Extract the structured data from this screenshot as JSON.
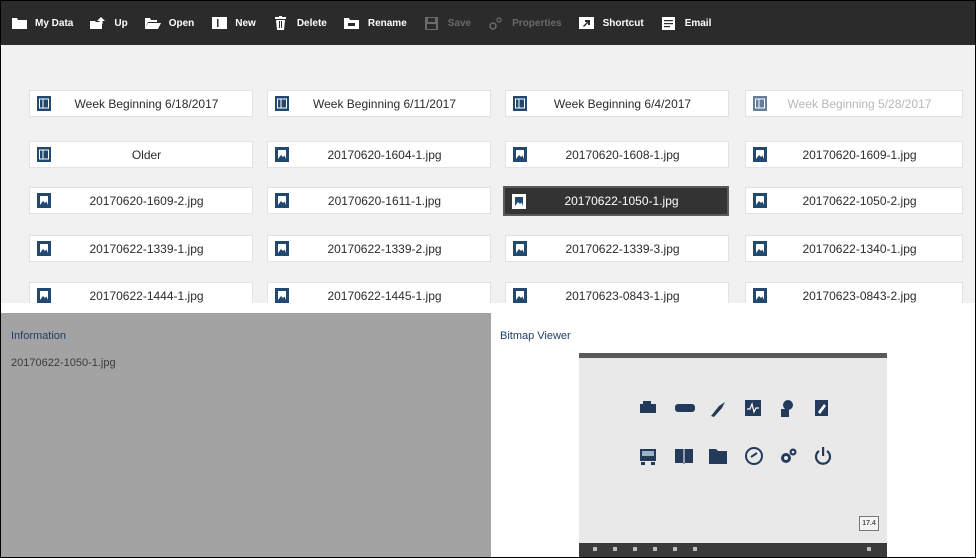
{
  "toolbar": {
    "items": [
      {
        "label": "My Data",
        "icon": "my-data-icon",
        "enabled": true
      },
      {
        "label": "Up",
        "icon": "up-folder-icon",
        "enabled": true
      },
      {
        "label": "Open",
        "icon": "open-folder-icon",
        "enabled": true
      },
      {
        "label": "New",
        "icon": "new-folder-icon",
        "enabled": true
      },
      {
        "label": "Delete",
        "icon": "trash-icon",
        "enabled": true
      },
      {
        "label": "Rename",
        "icon": "rename-icon",
        "enabled": true
      },
      {
        "label": "Save",
        "icon": "save-icon",
        "enabled": false
      },
      {
        "label": "Properties",
        "icon": "properties-icon",
        "enabled": false
      },
      {
        "label": "Shortcut",
        "icon": "shortcut-icon",
        "enabled": true
      },
      {
        "label": "Email",
        "icon": "email-icon",
        "enabled": true
      }
    ]
  },
  "browser": {
    "items": [
      {
        "label": "Week Beginning 6/18/2017",
        "type": "folder"
      },
      {
        "label": "Week Beginning 6/11/2017",
        "type": "folder"
      },
      {
        "label": "Week Beginning 6/4/2017",
        "type": "folder"
      },
      {
        "label": "Week Beginning 5/28/2017",
        "type": "folder",
        "faded": true
      },
      {
        "label": "Older",
        "type": "folder"
      },
      {
        "label": "20170620-1604-1.jpg",
        "type": "image"
      },
      {
        "label": "20170620-1608-1.jpg",
        "type": "image"
      },
      {
        "label": "20170620-1609-1.jpg",
        "type": "image"
      },
      {
        "label": "20170620-1609-2.jpg",
        "type": "image"
      },
      {
        "label": "20170620-1611-1.jpg",
        "type": "image"
      },
      {
        "label": "20170622-1050-1.jpg",
        "type": "image",
        "selected": true
      },
      {
        "label": "20170622-1050-2.jpg",
        "type": "image"
      },
      {
        "label": "20170622-1339-1.jpg",
        "type": "image"
      },
      {
        "label": "20170622-1339-2.jpg",
        "type": "image"
      },
      {
        "label": "20170622-1339-3.jpg",
        "type": "image"
      },
      {
        "label": "20170622-1340-1.jpg",
        "type": "image"
      },
      {
        "label": "20170622-1444-1.jpg",
        "type": "image"
      },
      {
        "label": "20170622-1445-1.jpg",
        "type": "image"
      },
      {
        "label": "20170623-0843-1.jpg",
        "type": "image"
      },
      {
        "label": "20170623-0843-2.jpg",
        "type": "image"
      }
    ]
  },
  "information": {
    "title": "Information",
    "filename": "20170622-1050-1.jpg"
  },
  "viewer": {
    "title": "Bitmap Viewer",
    "version": "17.4"
  },
  "colors": {
    "toolbar_bg": "#2b2b2b",
    "selected_tile": "#333333",
    "file_icon": "#23486f",
    "info_panel_bg": "#a3a3a3",
    "panel_title": "#1f3f66"
  }
}
